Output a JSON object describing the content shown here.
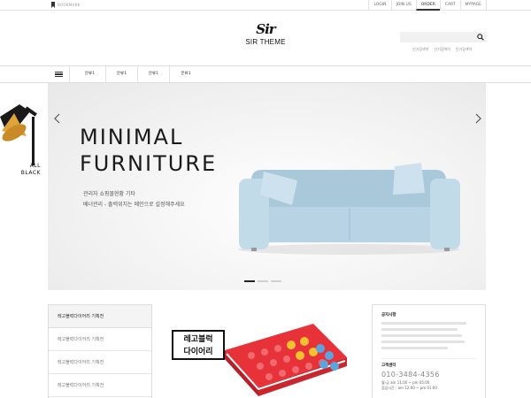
{
  "topbar": {
    "bookmark_label": "BOOKMARK",
    "util_nav": [
      "LOGIN",
      "JOIN US",
      "ORDER",
      "CART",
      "MYPAGE"
    ],
    "active_item": "ORDER"
  },
  "header": {
    "logo_mark": "Sir",
    "logo_text": "SIR THEME",
    "search_placeholder": "",
    "popular_keywords": [
      "인기검색어",
      "인기검색어",
      "인기검색어"
    ]
  },
  "nav": {
    "categories": [
      "분류1",
      "분류1",
      "분류1",
      "분류1"
    ]
  },
  "hero": {
    "title_line1": "MINIMAL",
    "title_line2": "FURNITURE",
    "desc_line1": "관리자 쇼핑몰현황 기타",
    "desc_line2": "배너관리 - 출력위치는 메인으로 설정해주세요",
    "slide_count": 3,
    "active_slide": 1
  },
  "side_ad": {
    "line1": "ALL",
    "line2": "BLACK"
  },
  "lower": {
    "list_heading": "레고블럭다이어리 기획전",
    "list_items": [
      "레고블럭다이어리 기획전",
      "레고블럭다이어리 기획전",
      "레고블럭다이어리 기획전"
    ],
    "feature_line1": "레고블럭",
    "feature_line2": "다이어리",
    "notice_heading": "공지사항",
    "cs_heading": "고객센터",
    "cs_phone": "010-3484-4356",
    "cs_hours_line1": "월-금 am 11:00 ~ pm 05:00",
    "cs_hours_line2": "점심시간 : am 12:00 ~ pm 01:00"
  },
  "colors": {
    "sofa": "#b8d4e4",
    "lego_red": "#e8323a",
    "lego_yellow": "#f6c12e",
    "lego_blue": "#5aa4e0"
  }
}
